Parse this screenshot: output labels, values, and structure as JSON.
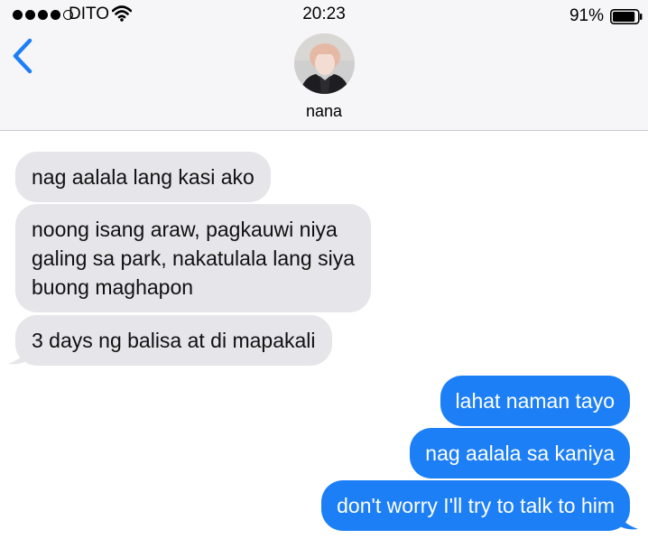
{
  "status_bar": {
    "carrier": "DITO",
    "time": "20:23",
    "battery_percent": "91%",
    "battery_level": 0.91,
    "signal_bars_filled": 4,
    "signal_bars_total": 5
  },
  "header": {
    "contact_name": "nana",
    "back_icon": "chevron-left-icon",
    "avatar_caption": "avatar photo"
  },
  "messages": [
    {
      "direction": "received",
      "text": "nag aalala lang kasi ako"
    },
    {
      "direction": "received",
      "lines": [
        "noong isang araw, pagkauwi niya",
        "galing sa park, nakatulala lang siya",
        "buong maghapon"
      ]
    },
    {
      "direction": "received",
      "text": "3 days ng balisa at di mapakali"
    },
    {
      "direction": "sent",
      "text": "lahat naman tayo"
    },
    {
      "direction": "sent",
      "text": "nag aalala sa kaniya"
    },
    {
      "direction": "sent",
      "text": "don't worry I'll try to talk to him"
    }
  ],
  "colors": {
    "accent": "#1d7ff6",
    "received_bubble": "#e5e5ea",
    "header_background": "#f6f6f8"
  }
}
